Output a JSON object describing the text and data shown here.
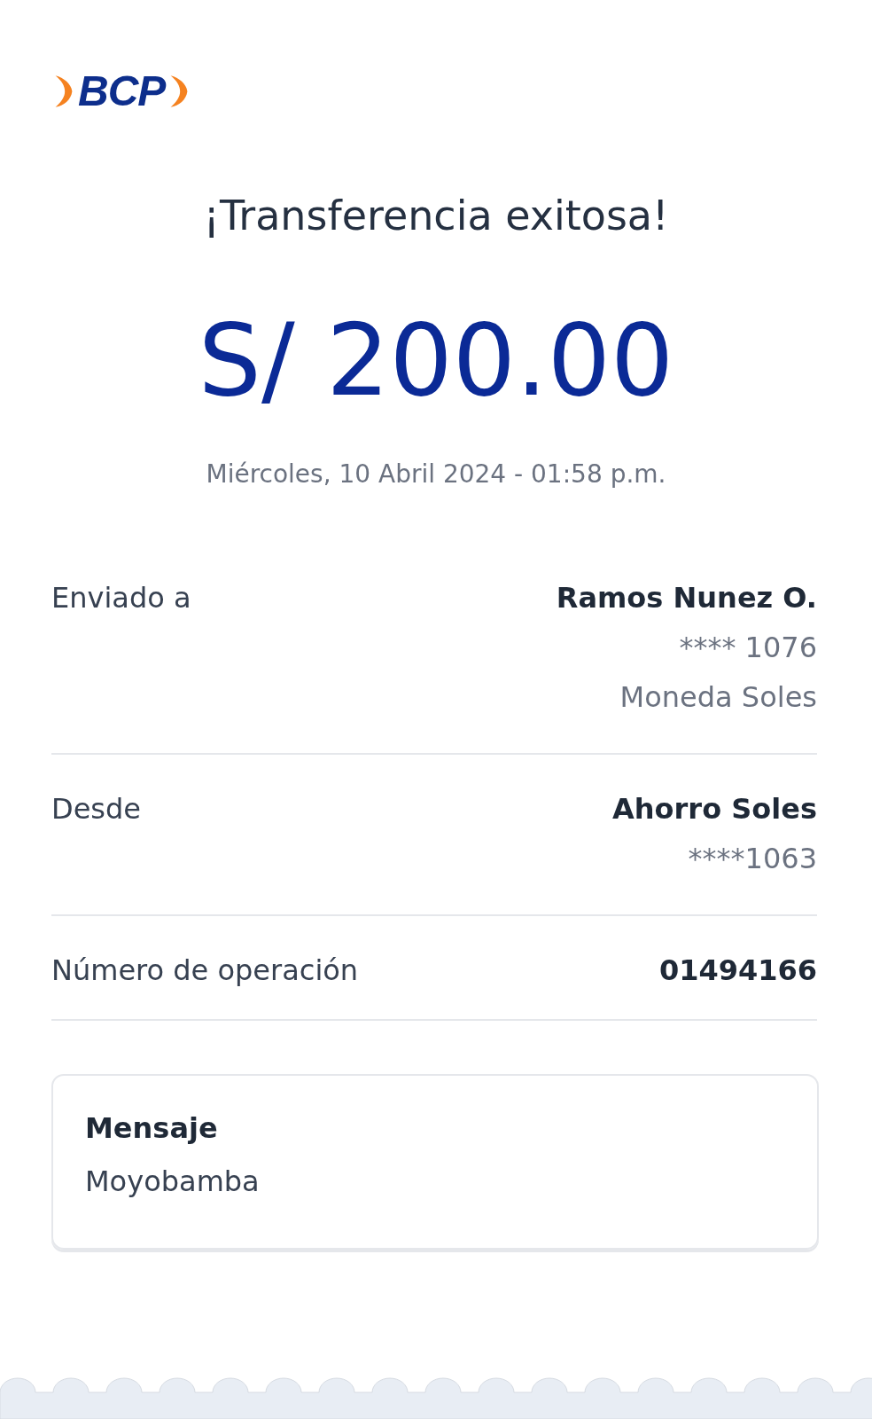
{
  "logo": {
    "text": "BCP"
  },
  "title": "¡Transferencia exitosa!",
  "amount": "S/ 200.00",
  "datetime": "Miércoles, 10 Abril 2024 - 01:58 p.m.",
  "details": [
    {
      "label": "Enviado a",
      "value": "Ramos Nunez O.",
      "extra": [
        "**** 1076",
        "Moneda Soles"
      ]
    },
    {
      "label": "Desde",
      "value": "Ahorro Soles",
      "extra": [
        "****1063"
      ]
    },
    {
      "label": "Número de operación",
      "value": "01494166"
    }
  ],
  "message": {
    "label": "Mensaje",
    "text": "Moyobamba"
  }
}
